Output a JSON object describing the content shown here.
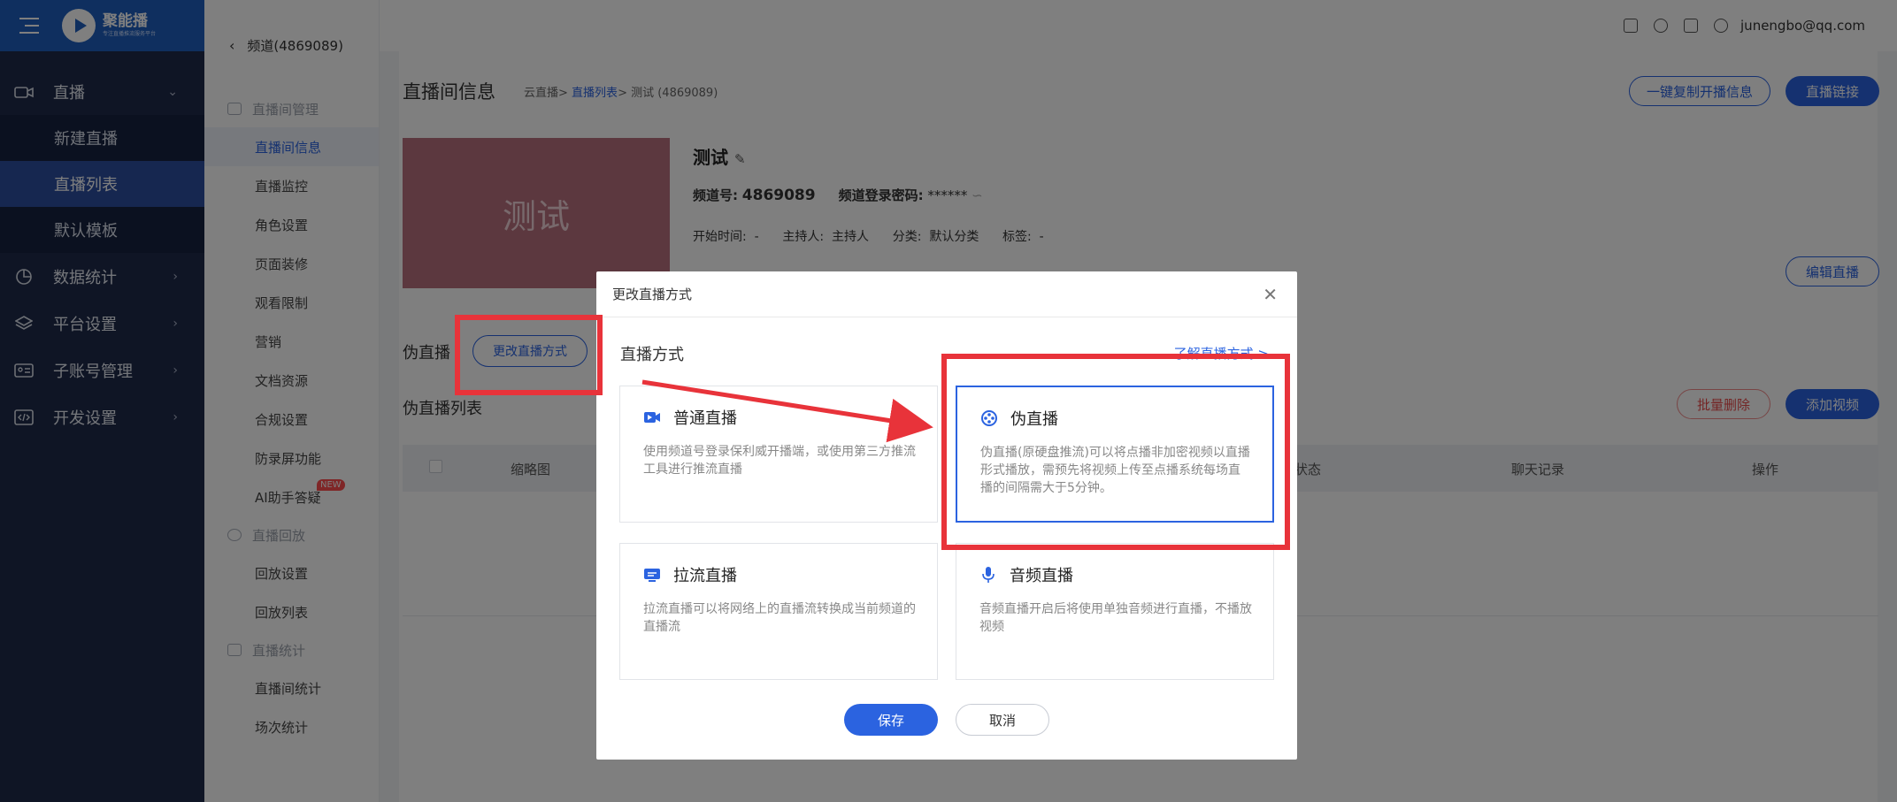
{
  "app": {
    "brand": "聚能播",
    "brand_sub": "专注直播推流服务平台",
    "user_email": "junengbo@qq.com"
  },
  "left_nav": {
    "live": "直播",
    "new_live": "新建直播",
    "live_list": "直播列表",
    "default_template": "默认模板",
    "stats": "数据统计",
    "platform": "平台设置",
    "sub_accounts": "子账号管理",
    "dev": "开发设置"
  },
  "sub_nav": {
    "back": "频道(4869089)",
    "sec_manage": "直播间管理",
    "items1": [
      "直播间信息",
      "直播监控",
      "角色设置",
      "页面装修",
      "观看限制",
      "营销",
      "文档资源",
      "合规设置",
      "防录屏功能",
      "AI助手答疑"
    ],
    "new_badge": "NEW",
    "sec_replay": "直播回放",
    "items2": [
      "回放设置",
      "回放列表"
    ],
    "sec_stats": "直播统计",
    "items3": [
      "直播间统计",
      "场次统计"
    ]
  },
  "page": {
    "title": "直播间信息",
    "breadcrumb_root": "云直播>",
    "breadcrumb_mid": "直播列表",
    "breadcrumb_tail": "> 测试 (4869089)",
    "copy_btn": "一键复制开播信息",
    "link_btn": "直播链接",
    "cover_text": "测试",
    "name": "测试",
    "channel_label": "频道号:",
    "channel_no": "4869089",
    "pwd_label": "频道登录密码:",
    "pwd_value": "******",
    "start_label": "开始时间:",
    "start_value": "-",
    "host_label": "主持人:",
    "host_value": "主持人",
    "cat_label": "分类:",
    "cat_value": "默认分类",
    "tag_label": "标签:",
    "tag_value": "-",
    "edit_btn": "编辑直播",
    "mode_label": "伪直播",
    "change_mode_btn": "更改直播方式",
    "list_label": "伪直播列表",
    "batch_delete": "批量删除",
    "add_video": "添加视频",
    "columns": [
      "缩略图",
      "状态",
      "聊天记录",
      "操作"
    ]
  },
  "modal": {
    "title": "更改直播方式",
    "section": "直播方式",
    "learn_link": "了解直播方式 >",
    "options": [
      {
        "title": "普通直播",
        "desc": "使用频道号登录保利威开播端，或使用第三方推流工具进行推流直播",
        "icon": "video-camera-icon"
      },
      {
        "title": "伪直播",
        "desc": "伪直播(原硬盘推流)可以将点播非加密视频以直播形式播放，需预先将视频上传至点播系统每场直播的间隔需大于5分钟。",
        "icon": "film-reel-icon"
      },
      {
        "title": "拉流直播",
        "desc": "拉流直播可以将网络上的直播流转换成当前频道的直播流",
        "icon": "stream-screen-icon"
      },
      {
        "title": "音频直播",
        "desc": "音频直播开启后将使用单独音频进行直播，不播放视频",
        "icon": "microphone-icon"
      }
    ],
    "selected": "伪直播",
    "save": "保存",
    "cancel": "取消"
  },
  "colors": {
    "primary": "#2b63e0",
    "sidebar": "#1e2a4a",
    "annotation": "#e8333a"
  }
}
